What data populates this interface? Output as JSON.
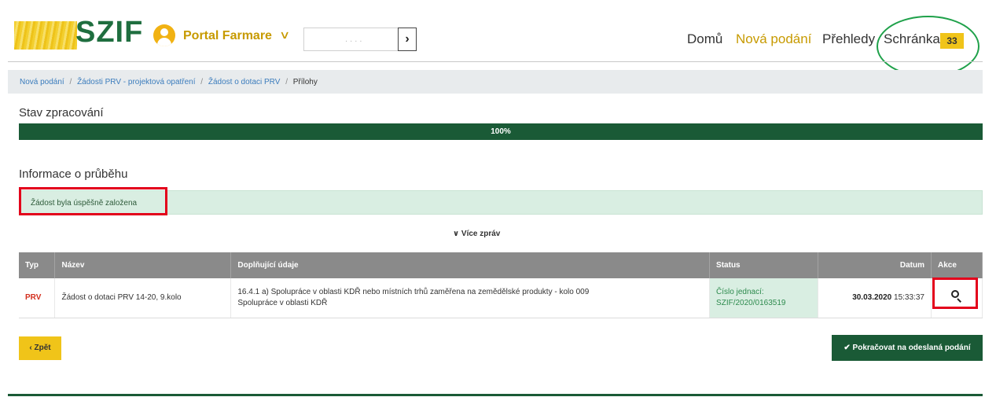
{
  "header": {
    "logo_text": "SZIF",
    "portal_title": "Portal Farmare",
    "portal_chevron": "∨",
    "search_value": ". . . .",
    "search_button": "›",
    "nav": [
      {
        "label": "Domů"
      },
      {
        "label": "Nová podání"
      },
      {
        "label": "Přehledy"
      },
      {
        "label": "Schránka"
      }
    ],
    "inbox_count": "33"
  },
  "breadcrumb": {
    "items": [
      "Nová podání",
      "Žádosti PRV - projektová opatření",
      "Žádost o dotaci PRV",
      "Přílohy"
    ],
    "separator": "/"
  },
  "status": {
    "title": "Stav zpracování",
    "progress_percent": 100,
    "progress_label": "100%"
  },
  "info": {
    "title": "Informace o průběhu",
    "alert_text": "Žádost byla úspěšně založena",
    "more_messages": "∨  Více zpráv"
  },
  "table": {
    "headers": {
      "typ": "Typ",
      "nazev": "Název",
      "doplnujici": "Doplňující údaje",
      "status": "Status",
      "datum": "Datum",
      "akce": "Akce"
    },
    "row": {
      "typ": "PRV",
      "nazev": "Žádost o dotaci PRV 14-20, 9.kolo",
      "doplnujici_line1": "16.4.1 a) Spolupráce v oblasti KDŘ nebo místních trhů zaměřena na zemědělské produkty - kolo 009",
      "doplnujici_line2": "Spolupráce v oblasti KDŘ",
      "status_line1": "Číslo jednací:",
      "status_line2": "SZIF/2020/0163519",
      "datum_date": "30.03.2020",
      "datum_time": "15:33:37",
      "akce_icon": "search-icon"
    }
  },
  "buttons": {
    "back": "‹ Zpět",
    "continue": "✔ Pokračovat na odeslaná podání"
  },
  "colors": {
    "brand_green": "#1a5a36",
    "accent_yellow": "#f0c419",
    "highlight_red": "#e3001b",
    "annotation_green": "#1fa14a"
  }
}
